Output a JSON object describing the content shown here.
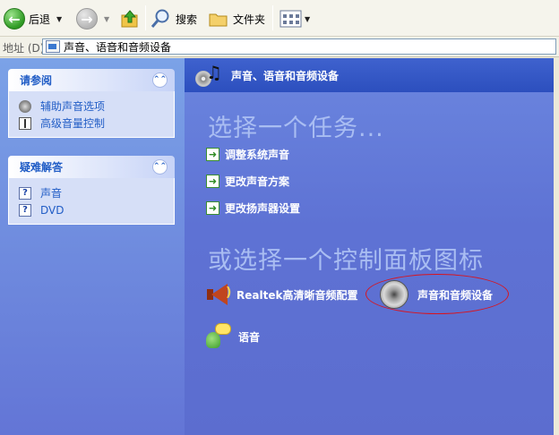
{
  "toolbar": {
    "back_label": "后退",
    "search_label": "搜索",
    "folders_label": "文件夹"
  },
  "address": {
    "label": "地址 (D)",
    "value": "声音、语音和音频设备"
  },
  "see_also": {
    "title": "请参阅",
    "items": [
      {
        "label": "辅助声音选项",
        "icon": "speaker-icon"
      },
      {
        "label": "高级音量控制",
        "icon": "volume-slider-icon"
      }
    ]
  },
  "troubleshoot": {
    "title": "疑难解答",
    "items": [
      {
        "label": "声音",
        "icon": "help-icon"
      },
      {
        "label": "DVD",
        "icon": "help-icon"
      }
    ]
  },
  "category": {
    "title": "声音、语音和音频设备"
  },
  "tasks": {
    "heading": "选择一个任务...",
    "items": [
      {
        "label": "调整系统声音"
      },
      {
        "label": "更改声音方案"
      },
      {
        "label": "更改扬声器设置"
      }
    ]
  },
  "control_panel": {
    "heading": "或选择一个控制面板图标",
    "items": [
      {
        "label": "Realtek高清晰音频配置",
        "icon": "realtek-audio-icon"
      },
      {
        "label": "声音和音频设备",
        "icon": "sound-audio-devices-icon",
        "highlighted": true
      },
      {
        "label": "语音",
        "icon": "speech-icon"
      }
    ]
  },
  "colors": {
    "task_pane_bg": "#6B86DF",
    "link_blue": "#215DC6",
    "highlight_circle": "#D8141F"
  }
}
